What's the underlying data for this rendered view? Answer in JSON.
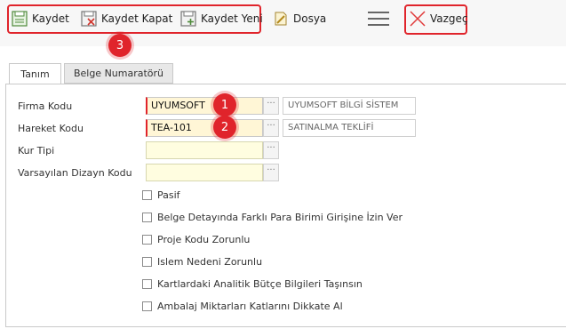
{
  "toolbar": {
    "save_label": "Kaydet",
    "save_close_label": "Kaydet Kapat",
    "save_new_label": "Kaydet Yeni",
    "file_label": "Dosya",
    "cancel_label": "Vazgeç"
  },
  "badges": {
    "b1": "1",
    "b2": "2",
    "b3": "3"
  },
  "tabs": [
    {
      "label": "Tanım"
    },
    {
      "label": "Belge Numaratörü"
    }
  ],
  "form": {
    "firma_kodu": {
      "label": "Firma Kodu",
      "value": "UYUMSOFT",
      "desc": "UYUMSOFT BİLGİ SİSTEM"
    },
    "hareket_kodu": {
      "label": "Hareket Kodu",
      "value": "TEA-101",
      "desc": "SATINALMA TEKLİFİ"
    },
    "kur_tipi": {
      "label": "Kur Tipi",
      "value": ""
    },
    "varsayilan_dizayn": {
      "label": "Varsayılan Dizayn Kodu",
      "value": ""
    },
    "lookup_button": "···"
  },
  "checkboxes": [
    {
      "label": "Pasif",
      "checked": false
    },
    {
      "label": "Belge Detayında Farklı Para Birimi Girişine İzin Ver",
      "checked": false
    },
    {
      "label": "Proje Kodu Zorunlu",
      "checked": false
    },
    {
      "label": "Islem Nedeni Zorunlu",
      "checked": false
    },
    {
      "label": "Kartlardaki Analitik Bütçe Bilgileri Taşınsın",
      "checked": false
    },
    {
      "label": "Ambalaj Miktarları Katlarını Dikkate Al",
      "checked": false
    }
  ]
}
